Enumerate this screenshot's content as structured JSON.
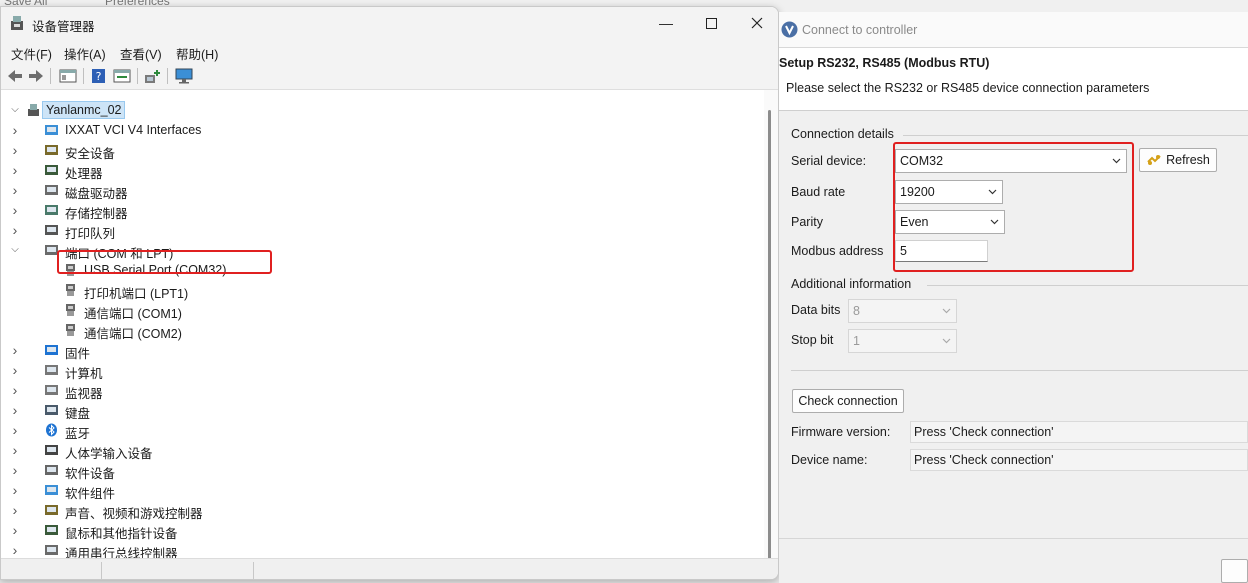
{
  "background": {
    "items": [
      "Save All",
      "Preferences"
    ]
  },
  "device_manager": {
    "title": "设备管理器",
    "menu": [
      "文件(F)",
      "操作(A)",
      "查看(V)",
      "帮助(H)"
    ],
    "root": "Yanlanmc_02",
    "categories": [
      "IXXAT VCI V4 Interfaces",
      "安全设备",
      "处理器",
      "磁盘驱动器",
      "存储控制器",
      "打印队列",
      "端口 (COM 和 LPT)"
    ],
    "ports": [
      "USB Serial Port (COM32)",
      "打印机端口 (LPT1)",
      "通信端口 (COM1)",
      "通信端口 (COM2)"
    ],
    "categories_after": [
      "固件",
      "计算机",
      "监视器",
      "键盘",
      "蓝牙",
      "人体学输入设备",
      "软件设备",
      "软件组件",
      "声音、视频和游戏控制器",
      "鼠标和其他指针设备",
      "通用串行总线控制器"
    ]
  },
  "connect": {
    "title": "Connect to controller",
    "heading": "Setup RS232, RS485 (Modbus RTU)",
    "subheading": "Please select the RS232 or RS485 device connection parameters",
    "connection_details": "Connection details",
    "serial_device_label": "Serial device:",
    "serial_device_value": "COM32",
    "refresh_label": "Refresh",
    "baud_rate_label": "Baud rate",
    "baud_rate_value": "19200",
    "parity_label": "Parity",
    "parity_value": "Even",
    "modbus_address_label": "Modbus address",
    "modbus_address_value": "5",
    "additional_info": "Additional information",
    "data_bits_label": "Data bits",
    "data_bits_value": "8",
    "stop_bit_label": "Stop bit",
    "stop_bit_value": "1",
    "check_connection_label": "Check connection",
    "firmware_label": "Firmware version:",
    "firmware_value": "Press 'Check connection'",
    "device_name_label": "Device name:",
    "device_name_value": "Press 'Check connection'"
  },
  "colors": {
    "highlight_red": "#e02020",
    "selection_blue": "#cde4f7"
  }
}
